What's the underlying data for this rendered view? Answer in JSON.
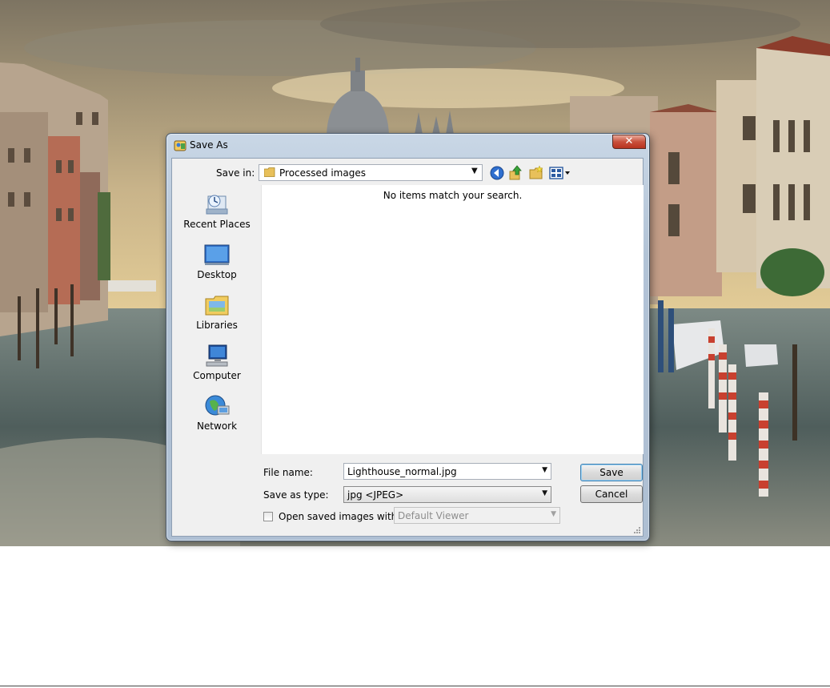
{
  "dialog": {
    "title": "Save As",
    "close_glyph": "✕",
    "save_in_label": "Save in:",
    "save_in_value": "Processed images",
    "empty_message": "No items match your search.",
    "places": [
      {
        "label": "Recent Places",
        "icon": "recent-places-icon"
      },
      {
        "label": "Desktop",
        "icon": "desktop-icon"
      },
      {
        "label": "Libraries",
        "icon": "libraries-icon"
      },
      {
        "label": "Computer",
        "icon": "computer-icon"
      },
      {
        "label": "Network",
        "icon": "network-icon"
      }
    ],
    "file_name_label": "File name:",
    "file_name_value": "Lighthouse_normal.jpg",
    "save_as_type_label": "Save as type:",
    "save_as_type_value": "jpg <JPEG>",
    "open_with_label": "Open saved images with:",
    "open_with_value": "Default Viewer",
    "open_with_checked": false,
    "save_button": "Save",
    "cancel_button": "Cancel"
  },
  "colors": {
    "title_bar": "#b9cadb",
    "close_button": "#c9503c",
    "default_button_border": "#3c7fb1"
  }
}
